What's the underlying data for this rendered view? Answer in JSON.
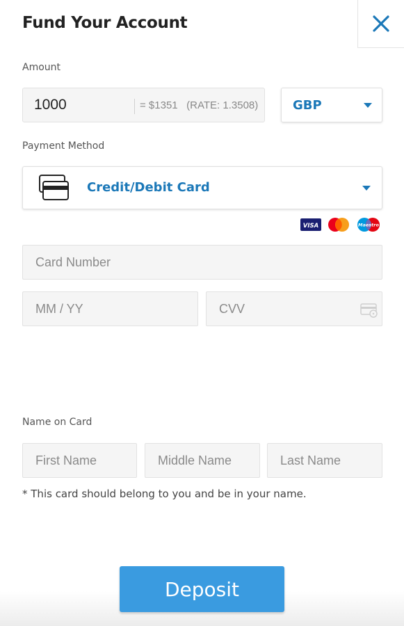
{
  "header": {
    "title": "Fund Your Account"
  },
  "amount": {
    "label": "Amount",
    "value": "1000",
    "conversion": "= $1351",
    "rate": "(RATE: 1.3508)"
  },
  "currency": {
    "selected": "GBP"
  },
  "payment_method": {
    "label": "Payment Method",
    "selected": "Credit/Debit Card",
    "brands": [
      "VISA",
      "Mastercard",
      "Maestro"
    ]
  },
  "card": {
    "number_placeholder": "Card Number",
    "expiry_placeholder": "MM / YY",
    "cvv_placeholder": "CVV"
  },
  "name": {
    "label": "Name on Card",
    "first_placeholder": "First Name",
    "middle_placeholder": "Middle Name",
    "last_placeholder": "Last Name",
    "note": "* This card should belong to you and be in your name."
  },
  "actions": {
    "deposit_label": "Deposit"
  },
  "colors": {
    "accent": "#1b78b8",
    "button": "#3a9be0",
    "field_bg": "#f5f5f5"
  }
}
